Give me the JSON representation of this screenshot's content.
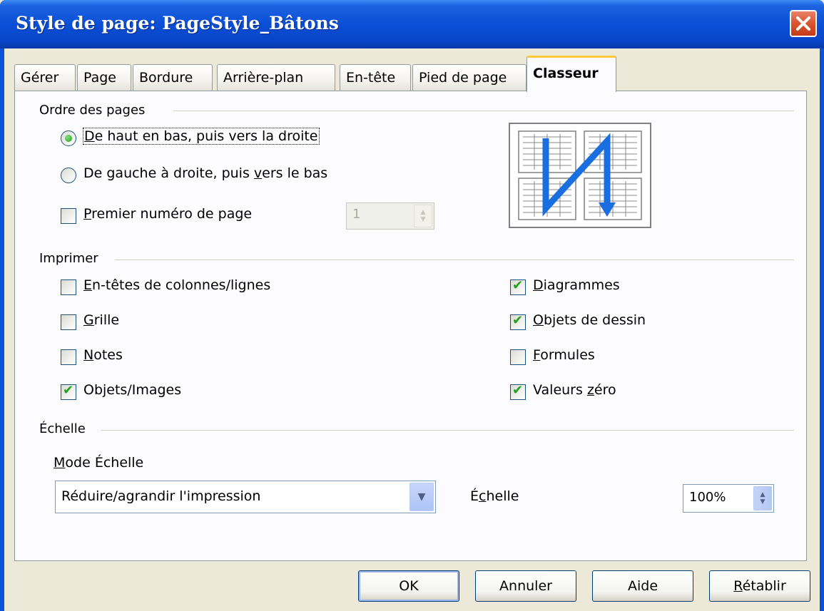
{
  "window": {
    "title": "Style de page: PageStyle_Bâtons"
  },
  "tabs": [
    {
      "label": "Gérer"
    },
    {
      "label": "Page"
    },
    {
      "label": "Bordure"
    },
    {
      "label": "Arrière-plan"
    },
    {
      "label": "En-tête"
    },
    {
      "label": "Pied de page"
    },
    {
      "label": "Classeur"
    }
  ],
  "active_tab": "Classeur",
  "page_order": {
    "group_label": "Ordre des pages",
    "option_top_bottom": {
      "label_hot": "D",
      "label_rest": "e haut en bas, puis vers la droite",
      "selected": true
    },
    "option_left_right": {
      "label_pre": "De gauche à droite, puis ",
      "label_hot": "v",
      "label_rest": "ers le bas",
      "selected": false
    },
    "first_page_number": {
      "label_hot": "P",
      "label_rest": "remier numéro de page",
      "checked": false,
      "value": "1"
    }
  },
  "print": {
    "group_label": "Imprimer",
    "headers": {
      "label_hot": "E",
      "label_rest": "n-têtes de colonnes/lignes",
      "checked": false
    },
    "grid": {
      "label_hot": "G",
      "label_rest": "rille",
      "checked": false
    },
    "notes": {
      "label_hot": "N",
      "label_rest": "otes",
      "checked": false
    },
    "objects_images": {
      "label": "Objets/Images",
      "checked": true
    },
    "charts": {
      "label_hot": "D",
      "label_rest": "iagrammes",
      "checked": true
    },
    "drawing_objects": {
      "label_hot": "O",
      "label_rest": "bjets de dessin",
      "checked": true
    },
    "formulas": {
      "label_hot": "F",
      "label_rest": "ormules",
      "checked": false
    },
    "zero_values": {
      "label_pre": "Valeurs ",
      "label_hot": "z",
      "label_rest": "éro",
      "checked": true
    }
  },
  "scale": {
    "group_label": "Échelle",
    "mode_label_hot": "M",
    "mode_label_rest": "ode Échelle",
    "mode_value": "Réduire/agrandir l'impression",
    "scale_label_pre": "É",
    "scale_label_hot": "c",
    "scale_label_rest": "helle",
    "scale_value": "100%"
  },
  "buttons": {
    "ok": "OK",
    "cancel": "Annuler",
    "help": "Aide",
    "reset_hot": "R",
    "reset_rest": "établir"
  },
  "colors": {
    "title_bar": "#0a4fd6",
    "tab_highlight": "#ffc83c",
    "check_green": "#21a121",
    "arrow_blue": "#1a6fe0"
  }
}
